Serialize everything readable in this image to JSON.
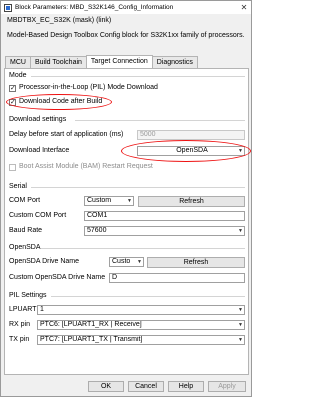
{
  "window": {
    "title": "Block Parameters: MBD_S32K146_Config_Information",
    "close_glyph": "✕"
  },
  "header": {
    "mask_line": "MBDTBX_EC_S32K (mask) (link)",
    "description": "Model-Based Design Toolbox Config block for S32K1xx family of processors."
  },
  "tabs": [
    {
      "label": "MCU",
      "active": false
    },
    {
      "label": "Build Toolchain",
      "active": false
    },
    {
      "label": "Target Connection",
      "active": true
    },
    {
      "label": "Diagnostics",
      "active": false
    }
  ],
  "mode": {
    "title": "Mode",
    "pil_label": "Processor-in-the-Loop (PIL) Mode Download",
    "pil_checked": true,
    "download_after_build_label": "Download Code after Build",
    "download_after_build_checked": true
  },
  "download": {
    "title": "Download settings",
    "delay_label": "Delay before start of application (ms)",
    "delay_value": "5000",
    "interface_label": "Download Interface",
    "interface_value": "OpenSDA",
    "bam_label": "Boot Assist Module (BAM) Restart Request",
    "bam_checked": false
  },
  "serial": {
    "title": "Serial",
    "com_port_label": "COM Port",
    "com_port_value": "Custom",
    "refresh_label": "Refresh",
    "custom_com_label": "Custom COM Port",
    "custom_com_value": "COM1",
    "baud_label": "Baud Rate",
    "baud_value": "57600"
  },
  "opensda": {
    "title": "OpenSDA",
    "drive_label": "OpenSDA Drive Name",
    "drive_value": "Custo",
    "refresh_label": "Refresh",
    "custom_drive_label": "Custom OpenSDA Drive Name",
    "custom_drive_value": "D"
  },
  "pil": {
    "title": "PIL Settings",
    "lpuart_label": "LPUART",
    "lpuart_value": "1",
    "rx_label": "RX pin",
    "rx_value": "PTC6: [LPUART1_RX | Receive]",
    "tx_label": "TX pin",
    "tx_value": "PTC7: [LPUART1_TX | Transmit]"
  },
  "buttons": {
    "ok": "OK",
    "cancel": "Cancel",
    "help": "Help",
    "apply": "Apply"
  },
  "colors": {
    "highlight": "#e11111"
  }
}
